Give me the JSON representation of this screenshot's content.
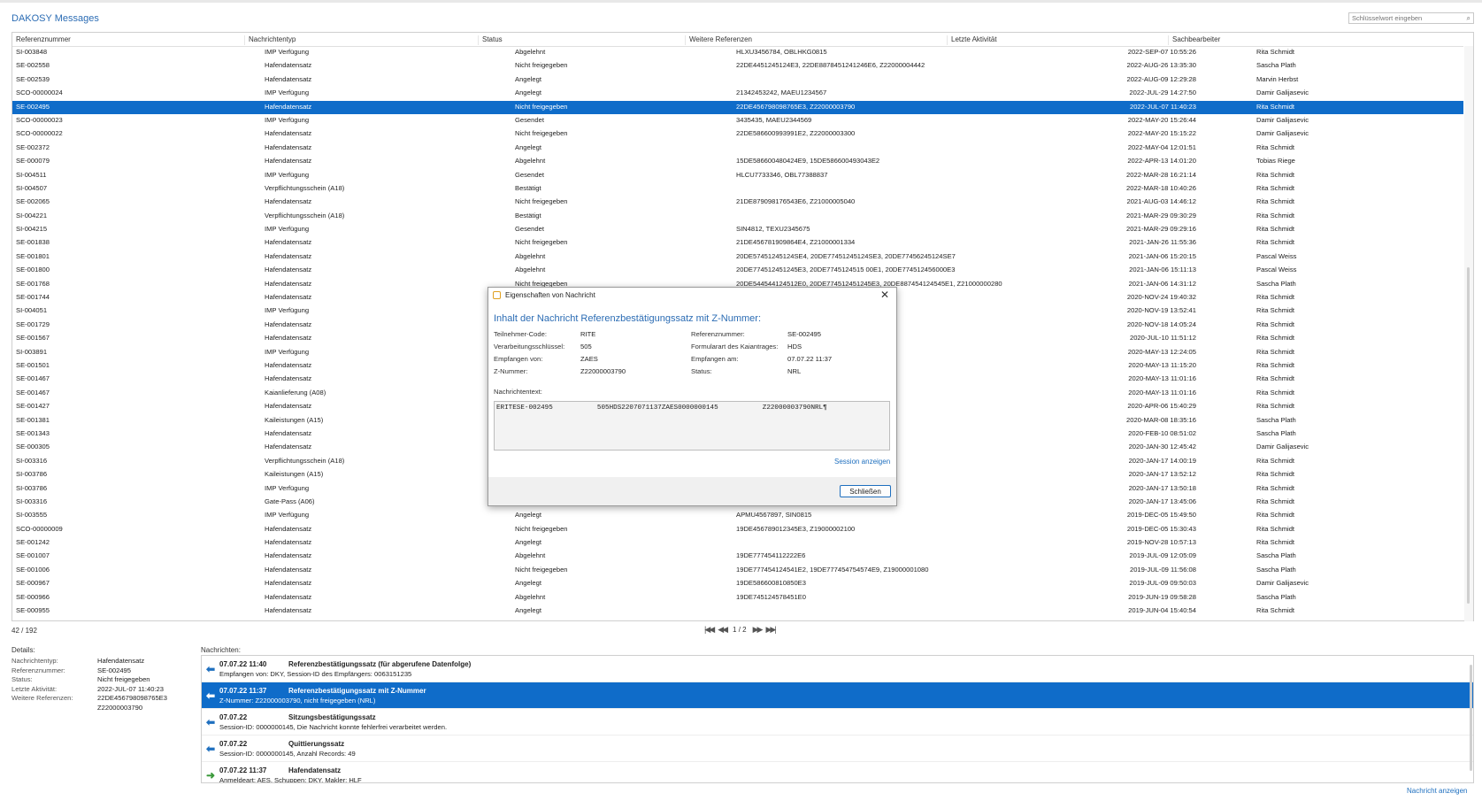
{
  "app": {
    "title": "DAKOSY Messages"
  },
  "search": {
    "placeholder": "Schlüsselwort eingeben"
  },
  "table": {
    "columns": [
      "Referenznummer",
      "Nachrichtentyp",
      "Status",
      "Weitere Referenzen",
      "Letzte Aktivität",
      "Sachbearbeiter"
    ],
    "rows": [
      [
        "SI-003848",
        "IMP Verfügung",
        "Abgelehnt",
        "HLXU3456784, OBLHKG0815",
        "2022-SEP-07 10:55:26",
        "Rita Schmidt"
      ],
      [
        "SE-002558",
        "Hafendatensatz",
        "Nicht freigegeben",
        "22DE4451245124E3, 22DE8878451241246E6, Z22000004442",
        "2022-AUG-26 13:35:30",
        "Sascha Plath"
      ],
      [
        "SE-002539",
        "Hafendatensatz",
        "Angelegt",
        "",
        "2022-AUG-09 12:29:28",
        "Marvin Herbst"
      ],
      [
        "SCO-00000024",
        "IMP Verfügung",
        "Angelegt",
        "21342453242, MAEU1234567",
        "2022-JUL-29 14:27:50",
        "Damir Galijasevic"
      ],
      [
        "SE-002495",
        "Hafendatensatz",
        "Nicht freigegeben",
        "22DE456798098765E3, Z22000003790",
        "2022-JUL-07 11:40:23",
        "Rita Schmidt"
      ],
      [
        "SCO-00000023",
        "IMP Verfügung",
        "Gesendet",
        "3435435, MAEU2344569",
        "2022-MAY-20 15:26:44",
        "Damir Galijasevic"
      ],
      [
        "SCO-00000022",
        "Hafendatensatz",
        "Nicht freigegeben",
        "22DE586600993991E2, Z22000003300",
        "2022-MAY-20 15:15:22",
        "Damir Galijasevic"
      ],
      [
        "SE-002372",
        "Hafendatensatz",
        "Angelegt",
        "",
        "2022-MAY-04 12:01:51",
        "Rita Schmidt"
      ],
      [
        "SE-000079",
        "Hafendatensatz",
        "Abgelehnt",
        "15DE586600480424E9, 15DE586600493043E2",
        "2022-APR-13 14:01:20",
        "Tobias Riege"
      ],
      [
        "SI-004511",
        "IMP Verfügung",
        "Gesendet",
        "HLCU7733346, OBL77388837",
        "2022-MAR-28 16:21:14",
        "Rita Schmidt"
      ],
      [
        "SI-004507",
        "Verpflichtungsschein (A18)",
        "Bestätigt",
        "",
        "2022-MAR-18 10:40:26",
        "Rita Schmidt"
      ],
      [
        "SE-002065",
        "Hafendatensatz",
        "Nicht freigegeben",
        "21DE879098176543E6, Z21000005040",
        "2021-AUG-03 14:46:12",
        "Rita Schmidt"
      ],
      [
        "SI-004221",
        "Verpflichtungsschein (A18)",
        "Bestätigt",
        "",
        "2021-MAR-29 09:30:29",
        "Rita Schmidt"
      ],
      [
        "SI-004215",
        "IMP Verfügung",
        "Gesendet",
        "SIN4812, TEXU2345675",
        "2021-MAR-29 09:29:16",
        "Rita Schmidt"
      ],
      [
        "SE-001838",
        "Hafendatensatz",
        "Nicht freigegeben",
        "21DE456781909864E4, Z21000001334",
        "2021-JAN-26 11:55:36",
        "Rita Schmidt"
      ],
      [
        "SE-001801",
        "Hafendatensatz",
        "Abgelehnt",
        "20DE57451245124SE4, 20DE77451245124SE3, 20DE77456245124SE7",
        "2021-JAN-06 15:20:15",
        "Pascal Weiss"
      ],
      [
        "SE-001800",
        "Hafendatensatz",
        "Abgelehnt",
        "20DE774512451245E3, 20DE7745124515 00E1, 20DE774512456000E3",
        "2021-JAN-06 15:11:13",
        "Pascal Weiss"
      ],
      [
        "SE-001768",
        "Hafendatensatz",
        "Nicht freigegeben",
        "20DE544544124512E0, 20DE774512451245E3, 20DE887454124545E1, Z21000000280",
        "2021-JAN-06 14:31:12",
        "Sascha Plath"
      ],
      [
        "SE-001744",
        "Hafendatensatz",
        "",
        "",
        "2020-NOV-24 19:40:32",
        "Rita Schmidt"
      ],
      [
        "SI-004051",
        "IMP Verfügung",
        "",
        "",
        "2020-NOV-19 13:52:41",
        "Rita Schmidt"
      ],
      [
        "SE-001729",
        "Hafendatensatz",
        "",
        "",
        "2020-NOV-18 14:05:24",
        "Rita Schmidt"
      ],
      [
        "SE-001567",
        "Hafendatensatz",
        "",
        "",
        "2020-JUL-10 11:51:12",
        "Rita Schmidt"
      ],
      [
        "SI-003891",
        "IMP Verfügung",
        "",
        "",
        "2020-MAY-13 12:24:05",
        "Rita Schmidt"
      ],
      [
        "SE-001501",
        "Hafendatensatz",
        "",
        "",
        "2020-MAY-13 11:15:20",
        "Rita Schmidt"
      ],
      [
        "SE-001467",
        "Hafendatensatz",
        "",
        "",
        "2020-MAY-13 11:01:16",
        "Rita Schmidt"
      ],
      [
        "SE-001467",
        "Kaianlieferung (A08)",
        "",
        "",
        "2020-MAY-13 11:01:16",
        "Rita Schmidt"
      ],
      [
        "SE-001427",
        "Hafendatensatz",
        "",
        "",
        "2020-APR-06 15:40:29",
        "Rita Schmidt"
      ],
      [
        "SE-001381",
        "Kaileistungen (A15)",
        "",
        "",
        "2020-MAR-08 18:35:16",
        "Sascha Plath"
      ],
      [
        "SE-001343",
        "Hafendatensatz",
        "",
        "",
        "2020-FEB-10 08:51:02",
        "Sascha Plath"
      ],
      [
        "SE-000305",
        "Hafendatensatz",
        "",
        "",
        "2020-JAN-30 12:45:42",
        "Damir Galijasevic"
      ],
      [
        "SI-003316",
        "Verpflichtungsschein (A18)",
        "",
        "",
        "2020-JAN-17 14:00:19",
        "Rita Schmidt"
      ],
      [
        "SI-003786",
        "Kaileistungen (A15)",
        "",
        "",
        "2020-JAN-17 13:52:12",
        "Rita Schmidt"
      ],
      [
        "SI-003786",
        "IMP Verfügung",
        "",
        "",
        "2020-JAN-17 13:50:18",
        "Rita Schmidt"
      ],
      [
        "SI-003316",
        "Gate-Pass (A06)",
        "",
        "",
        "2020-JAN-17 13:45:06",
        "Rita Schmidt"
      ],
      [
        "SI-003555",
        "IMP Verfügung",
        "Angelegt",
        "APMU4567897, SIN0815",
        "2019-DEC-05 15:49:50",
        "Rita Schmidt"
      ],
      [
        "SCO-00000009",
        "Hafendatensatz",
        "Nicht freigegeben",
        "19DE456789012345E3, Z19000002100",
        "2019-DEC-05 15:30:43",
        "Rita Schmidt"
      ],
      [
        "SE-001242",
        "Hafendatensatz",
        "Angelegt",
        "",
        "2019-NOV-28 10:57:13",
        "Rita Schmidt"
      ],
      [
        "SE-001007",
        "Hafendatensatz",
        "Abgelehnt",
        "19DE777454112222E6",
        "2019-JUL-09 12:05:09",
        "Sascha Plath"
      ],
      [
        "SE-001006",
        "Hafendatensatz",
        "Nicht freigegeben",
        "19DE777454124541E2, 19DE777454754574E9, Z19000001080",
        "2019-JUL-09 11:56:08",
        "Sascha Plath"
      ],
      [
        "SE-000967",
        "Hafendatensatz",
        "Angelegt",
        "19DE586600810850E3",
        "2019-JUL-09 09:50:03",
        "Damir Galijasevic"
      ],
      [
        "SE-000966",
        "Hafendatensatz",
        "Abgelehnt",
        "19DE745124578451E0",
        "2019-JUN-19 09:58:28",
        "Sascha Plath"
      ],
      [
        "SE-000955",
        "Hafendatensatz",
        "Angelegt",
        "",
        "2019-JUN-04 15:40:54",
        "Rita Schmidt"
      ]
    ],
    "selected_index": 4
  },
  "pagination": {
    "count": "42 / 192",
    "page": "1 / 2"
  },
  "details": {
    "label": "Details:",
    "fields": [
      {
        "label": "Nachrichtentyp:",
        "value": "Hafendatensatz"
      },
      {
        "label": "Referenznummer:",
        "value": "SE-002495"
      },
      {
        "label": "Status:",
        "value": "Nicht freigegeben"
      },
      {
        "label": "Letzte Aktivität:",
        "value": "2022-JUL-07 11:40:23"
      },
      {
        "label": "Weitere Referenzen:",
        "value": "22DE456798098765E3"
      },
      {
        "label": "",
        "value": "Z22000003790"
      }
    ]
  },
  "messages": {
    "label": "Nachrichten:",
    "items": [
      {
        "time": "07.07.22 11:40",
        "title": "Referenzbestätigungssatz (für abgerufene Datenfolge)",
        "sub": "Empfangen von: DKY, Session-ID des Empfängers: 0063151235",
        "direction": "in"
      },
      {
        "time": "07.07.22 11:37",
        "title": "Referenzbestätigungssatz mit Z-Nummer",
        "sub": "Z-Nummer: Z22000003790, nicht freigegeben (NRL)",
        "direction": "in"
      },
      {
        "time": "07.07.22",
        "title": "Sitzungsbestätigungssatz",
        "sub": "Session-ID: 0000000145, Die Nachricht konnte fehlerfrei verarbeitet werden.",
        "direction": "in"
      },
      {
        "time": "07.07.22",
        "title": "Quittierungssatz",
        "sub": "Session-ID: 0000000145, Anzahl Records: 49",
        "direction": "in"
      },
      {
        "time": "07.07.22 11:37",
        "title": "Hafendatensatz",
        "sub": "Anmeldeart: AES, Schuppen: DKY, Makler: HLF",
        "direction": "out"
      }
    ],
    "selected_index": 1
  },
  "footer": {
    "show_message": "Nachricht anzeigen"
  },
  "dialog": {
    "title": "Eigenschaften von Nachricht",
    "heading": "Inhalt der Nachricht Referenzbestätigungssatz mit Z-Nummer:",
    "left_fields": [
      {
        "label": "Teilnehmer-Code:",
        "value": "RITE"
      },
      {
        "label": "Verarbeitungsschlüssel:",
        "value": "505"
      },
      {
        "label": "Empfangen von:",
        "value": "ZAES"
      },
      {
        "label": "Z-Nummer:",
        "value": "Z22000003790"
      }
    ],
    "right_fields": [
      {
        "label": "Referenznummer:",
        "value": "SE-002495"
      },
      {
        "label": "Formularart des Kaiantrages:",
        "value": "HDS"
      },
      {
        "label": "Empfangen am:",
        "value": "07.07.22 11:37"
      },
      {
        "label": "Status:",
        "value": "NRL"
      }
    ],
    "text_label": "Nachrichtentext:",
    "text_content": "ERITESE-002495           505HDS2207071137ZAES0000000145           Z22000003790NRL¶",
    "session_link": "Session anzeigen",
    "close_button": "Schließen"
  },
  "colors": {
    "accent": "#0f6cc9",
    "title_blue": "#2b6cb4"
  }
}
